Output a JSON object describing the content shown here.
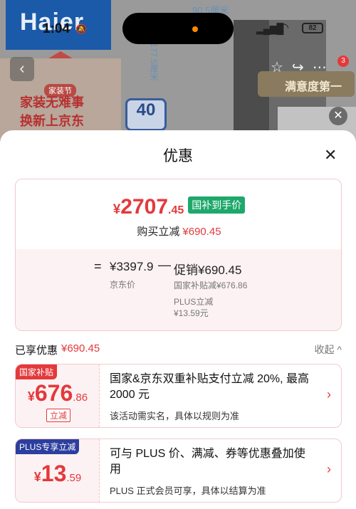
{
  "status_bar": {
    "time": "1:04",
    "battery": "82"
  },
  "background": {
    "brand": "Haier",
    "dimension_width": "90.5厘米",
    "dimension_height": "177.5厘米",
    "promo_line1": "家装无难事",
    "promo_line2": "换新上京东",
    "promo_badge": "家装节",
    "badge_40": "40",
    "satisfaction_label": "满意度第一",
    "cart_count": "3"
  },
  "sheet": {
    "title": "优惠",
    "price_card": {
      "yen": "¥",
      "price_int": "2707",
      "price_dec": ".45",
      "price_tag": "国补到手价",
      "reduce_label": "购买立减",
      "reduce_amount": "¥690.45",
      "breakdown": {
        "eq": "=",
        "base_price": "¥3397.9",
        "base_label": "京东价",
        "minus": "—",
        "promo": "促销¥690.45",
        "sub1": "国家补贴减¥676.86",
        "sub2": "PLUS立减",
        "sub2_amount": "¥13.59元"
      }
    },
    "enjoy": {
      "label": "已享优惠",
      "amount": "¥690.45",
      "collapse": "收起 ^"
    },
    "coupons": [
      {
        "tag": "国家补贴",
        "tag_color": "#e4393c",
        "yen": "¥",
        "int": "676",
        "dec": ".86",
        "sub": "立减",
        "title": "国家&京东双重补贴支付立减 20%, 最高 2000 元",
        "desc": "该活动需实名，具体以规则为准",
        "arrow": "›"
      },
      {
        "tag": "PLUS专享立减",
        "tag_color": "#2c3e9e",
        "yen": "¥",
        "int": "13",
        "dec": ".59",
        "title": "可与 PLUS 价、满减、券等优惠叠加使用",
        "desc": "PLUS 正式会员可享，具体以结算为准",
        "arrow": "›"
      }
    ]
  },
  "colors": {
    "accent_red": "#e4393c",
    "green_tag": "#1ea86b",
    "plus_blue": "#2c3e9e"
  }
}
